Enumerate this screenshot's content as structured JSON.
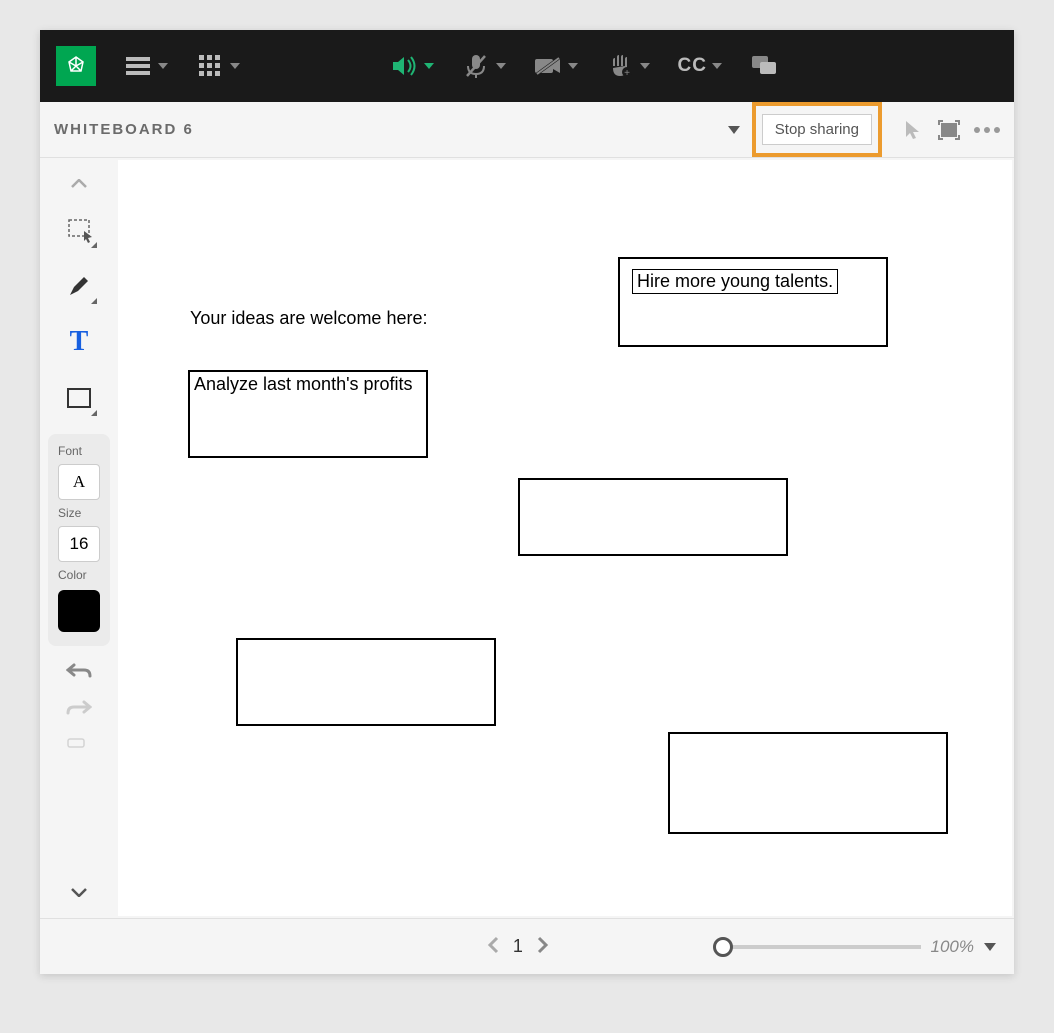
{
  "header": {
    "title": "WHITEBOARD 6",
    "stop_sharing": "Stop sharing"
  },
  "topbar_icons": {
    "logo": "adobe-connect",
    "menu": "menu",
    "grid": "pod-options",
    "speaker": "speaker",
    "mic": "microphone-muted",
    "camera": "camera-off",
    "hand": "raise-hand",
    "cc": "CC",
    "chat": "chat"
  },
  "tools": {
    "select": "select",
    "marker": "marker",
    "text": "text",
    "shape": "rectangle"
  },
  "props": {
    "font_label": "Font",
    "font_value": "A",
    "size_label": "Size",
    "size_value": "16",
    "color_label": "Color",
    "color_value": "#000000"
  },
  "canvas": {
    "prompt": "Your ideas are welcome here:",
    "box1_text": "Analyze last month's profits",
    "box2_text": "Hire more young talents."
  },
  "footer": {
    "page": "1",
    "zoom": "100%"
  }
}
